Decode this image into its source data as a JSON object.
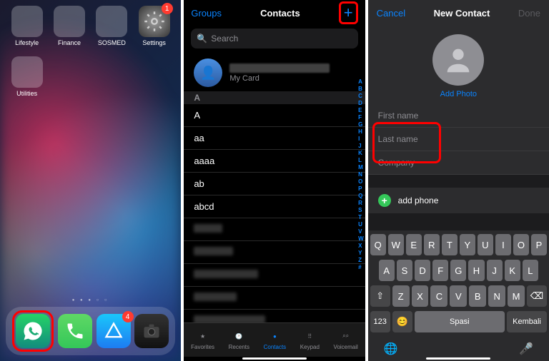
{
  "panel1": {
    "apps": [
      {
        "label": "Lifestyle",
        "type": "folder"
      },
      {
        "label": "Finance",
        "type": "folder"
      },
      {
        "label": "SOSMED",
        "type": "folder"
      },
      {
        "label": "Settings",
        "type": "settings",
        "badge": "1"
      },
      {
        "label": "Utilities",
        "type": "folder"
      }
    ],
    "dock": [
      {
        "name": "whatsapp",
        "highlighted": true
      },
      {
        "name": "phone"
      },
      {
        "name": "appstore",
        "badge": "4"
      },
      {
        "name": "camera"
      }
    ]
  },
  "panel2": {
    "groups_label": "Groups",
    "title": "Contacts",
    "search_placeholder": "Search",
    "mycard_label": "My Card",
    "section": "A",
    "contacts": [
      "A",
      "aa",
      "aaaa",
      "ab",
      "abcd"
    ],
    "index": [
      "A",
      "B",
      "C",
      "D",
      "E",
      "F",
      "G",
      "H",
      "I",
      "J",
      "K",
      "L",
      "M",
      "N",
      "O",
      "P",
      "Q",
      "R",
      "S",
      "T",
      "U",
      "V",
      "W",
      "X",
      "Y",
      "Z",
      "#"
    ],
    "tabs": [
      {
        "label": "Favorites",
        "icon": "star"
      },
      {
        "label": "Recents",
        "icon": "clock"
      },
      {
        "label": "Contacts",
        "icon": "person",
        "active": true
      },
      {
        "label": "Keypad",
        "icon": "grid"
      },
      {
        "label": "Voicemail",
        "icon": "voicemail"
      }
    ]
  },
  "panel3": {
    "cancel": "Cancel",
    "title": "New Contact",
    "done": "Done",
    "add_photo": "Add Photo",
    "first_name": "First name",
    "last_name": "Last name",
    "company": "Company",
    "add_phone": "add phone",
    "keyboard": {
      "row1": [
        "Q",
        "W",
        "E",
        "R",
        "T",
        "Y",
        "U",
        "I",
        "O",
        "P"
      ],
      "row2": [
        "A",
        "S",
        "D",
        "F",
        "G",
        "H",
        "J",
        "K",
        "L"
      ],
      "row3": [
        "Z",
        "X",
        "C",
        "V",
        "B",
        "N",
        "M"
      ],
      "num": "123",
      "space": "Spasi",
      "return": "Kembali"
    }
  }
}
